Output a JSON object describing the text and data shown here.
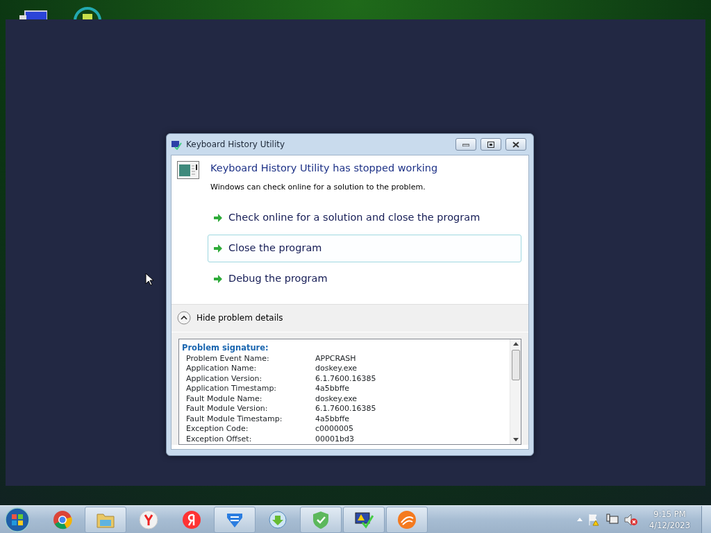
{
  "dialog": {
    "title": "Keyboard History Utility",
    "heading": "Keyboard History Utility has stopped working",
    "message": "Windows can check online for a solution to the problem.",
    "options": [
      {
        "label": "Check online for a solution and close the program",
        "selected": false
      },
      {
        "label": "Close the program",
        "selected": true
      },
      {
        "label": "Debug the program",
        "selected": false
      }
    ],
    "details_toggle": {
      "label": "Hide problem details",
      "expanded": true
    },
    "details": {
      "heading": "Problem signature:",
      "rows": [
        {
          "name": "Problem Event Name:",
          "value": "APPCRASH"
        },
        {
          "name": "Application Name:",
          "value": "doskey.exe"
        },
        {
          "name": "Application Version:",
          "value": "6.1.7600.16385"
        },
        {
          "name": "Application Timestamp:",
          "value": "4a5bbffe"
        },
        {
          "name": "Fault Module Name:",
          "value": "doskey.exe"
        },
        {
          "name": "Fault Module Version:",
          "value": "6.1.7600.16385"
        },
        {
          "name": "Fault Module Timestamp:",
          "value": "4a5bbffe"
        },
        {
          "name": "Exception Code:",
          "value": "c0000005"
        },
        {
          "name": "Exception Offset:",
          "value": "00001bd3"
        }
      ]
    }
  },
  "taskbar": {
    "items": [
      {
        "kind": "chrome",
        "running": false
      },
      {
        "kind": "folder",
        "running": true
      },
      {
        "kind": "ybrowser",
        "running": false
      },
      {
        "kind": "yandex",
        "running": false
      },
      {
        "kind": "bluelogo",
        "running": true
      },
      {
        "kind": "download",
        "running": false
      },
      {
        "kind": "shield",
        "running": true
      },
      {
        "kind": "monitor",
        "running": true
      },
      {
        "kind": "orange",
        "running": true
      }
    ],
    "time": "9:15 PM",
    "date": "4/12/2023"
  }
}
